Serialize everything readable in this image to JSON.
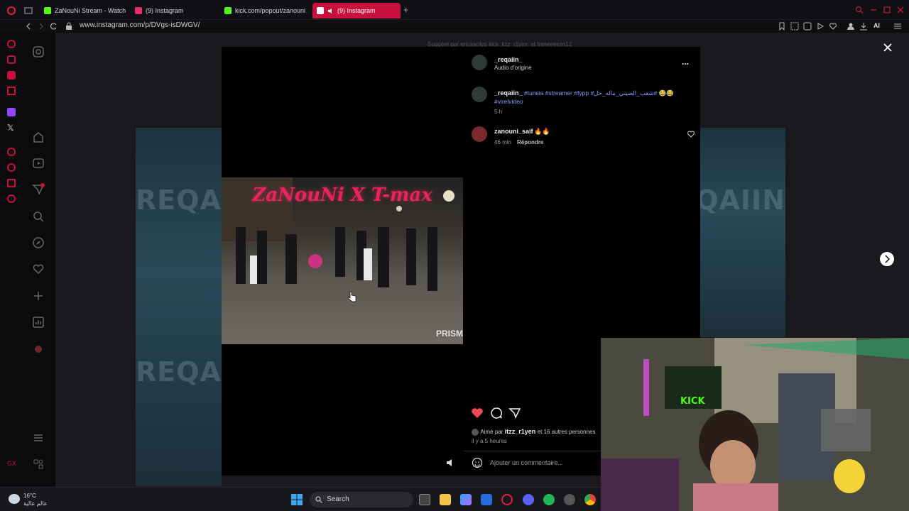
{
  "browser": {
    "tabs": [
      {
        "label": "ZaNouNi Stream - Watch L",
        "color": "#53fc18"
      },
      {
        "label": "(9) Instagram",
        "color": "#e1306c"
      },
      {
        "label": "kick.com/popout/zanouni",
        "color": "#53fc18"
      },
      {
        "label": "(9) Instagram",
        "color": "#e1306c"
      }
    ],
    "new_tab": "+",
    "url": "www.instagram.com/p/DVgs-isDWGV/",
    "ai_label": "AI"
  },
  "post": {
    "liked_by_header": "Suggéré par ericaaclips kick_itzz_r1yen_et freeeeeeze12",
    "author": "_reqaiin_",
    "audio": "Audio d'origine",
    "more": "...",
    "caption_user": "_reqaiin_",
    "caption_tags": "#tunsia #streamer #fypp #شعب_الصيني_ماله_حل# 😂😂 #virelvideo",
    "caption_time": "5 h",
    "comment_user": "zanouni_saif",
    "comment_text": "🔥🔥",
    "comment_time": "46 min",
    "comment_reply": "Répondre",
    "likes_prefix": "Aimé par",
    "likes_user": "itzz_r1yen",
    "likes_suffix": "et 16 autres personnes",
    "post_time": "il y a 5 heures",
    "comment_placeholder": "Ajouter un commentaire..."
  },
  "video": {
    "overlay_title": "ZaNouNi X T-max",
    "watermark": "PRISM",
    "bg_text": "REQAIIN"
  },
  "taskbar": {
    "temperature": "16°C",
    "location": "عالم عالية",
    "search": "Search"
  },
  "colors": {
    "accent": "#c8103c",
    "like": "#ed4956",
    "link": "#7f9cff"
  }
}
